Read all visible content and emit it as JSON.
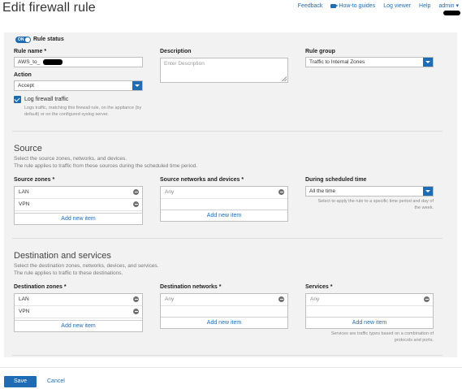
{
  "page": {
    "title": "Edit firewall rule"
  },
  "topnav": {
    "feedback": "Feedback",
    "howto": "How-to guides",
    "logviewer": "Log viewer",
    "help": "Help",
    "admin": "admin"
  },
  "rule": {
    "status_toggle": "ON",
    "status_label": "Rule status",
    "name_label": "Rule name *",
    "name_value": "AWS_to_",
    "description_label": "Description",
    "description_placeholder": "Enter Description",
    "group_label": "Rule group",
    "group_value": "Traffic to Internal Zones",
    "action_label": "Action",
    "action_value": "Accept",
    "log_label": "Log firewall traffic",
    "log_checked": true,
    "log_hint": "Logs traffic, matching this firewall rule, on the appliance (by default) or on the configured syslog server."
  },
  "source": {
    "title": "Source",
    "desc_line1": "Select the source zones, networks, and devices.",
    "desc_line2": "The rule applies to traffic from these sources during the scheduled time period.",
    "zones_label": "Source zones *",
    "zones": [
      "LAN",
      "VPN"
    ],
    "networks_label": "Source networks and devices *",
    "networks": [
      "Any"
    ],
    "schedule_label": "During scheduled time",
    "schedule_value": "All the time",
    "schedule_hint": "Select to apply the rule to a specific time period and day of the week.",
    "add_new": "Add new item"
  },
  "destination": {
    "title": "Destination and services",
    "desc_line1": "Select the destination zones, networks, devices, and services.",
    "desc_line2": "The rule applies to traffic to these destinations.",
    "zones_label": "Destination zones *",
    "zones": [
      "LAN",
      "VPN"
    ],
    "networks_label": "Destination networks *",
    "networks": [
      "Any"
    ],
    "services_label": "Services *",
    "services": [
      "Any"
    ],
    "services_hint": "Services are traffic types based on a combination of protocols and ports.",
    "add_new": "Add new item"
  },
  "footer": {
    "save": "Save",
    "cancel": "Cancel"
  },
  "colors": {
    "accent": "#1f6cb5",
    "panel": "#f2f2f2"
  }
}
